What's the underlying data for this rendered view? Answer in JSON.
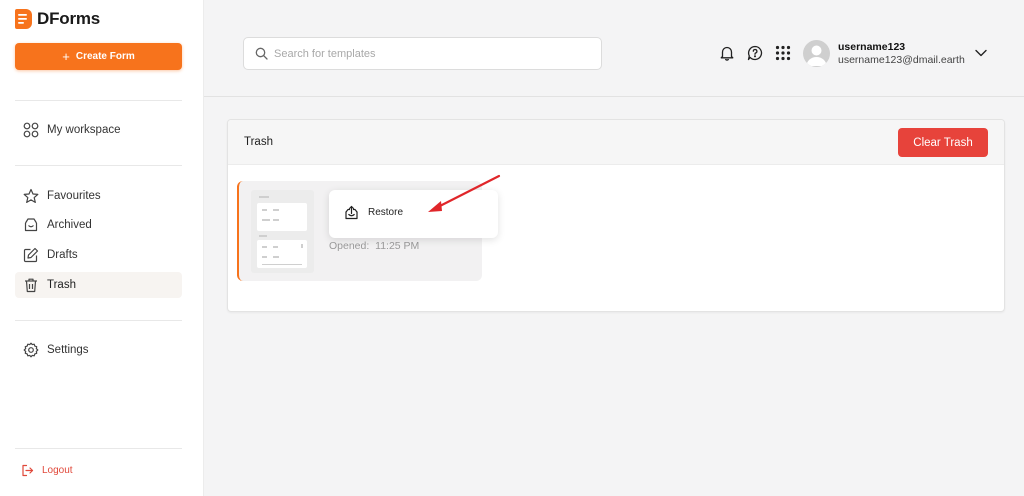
{
  "brand": {
    "name": "DForms",
    "accent": "#f7731c"
  },
  "sidebar": {
    "create_label": "Create Form",
    "workspace_label": "My workspace",
    "items": [
      {
        "label": "Favourites",
        "icon": "star-icon"
      },
      {
        "label": "Archived",
        "icon": "archive-icon"
      },
      {
        "label": "Drafts",
        "icon": "edit-icon"
      },
      {
        "label": "Trash",
        "icon": "trash-icon",
        "active": true
      }
    ],
    "settings_label": "Settings",
    "logout_label": "Logout"
  },
  "header": {
    "search_placeholder": "Search for templates",
    "user": {
      "name": "username123",
      "email": "username123@dmail.earth"
    },
    "icons": [
      "bell-icon",
      "help-chat-icon",
      "apps-grid-icon",
      "avatar",
      "chevron-down-icon"
    ]
  },
  "main": {
    "title": "Trash",
    "clear_label": "Clear Trash",
    "clear_color": "#e7433b",
    "form_card": {
      "opened_label": "Opened:",
      "opened_time": "11:25 PM"
    },
    "context_menu": {
      "restore_label": "Restore"
    },
    "annotation_arrow_color": "#e0262a"
  }
}
